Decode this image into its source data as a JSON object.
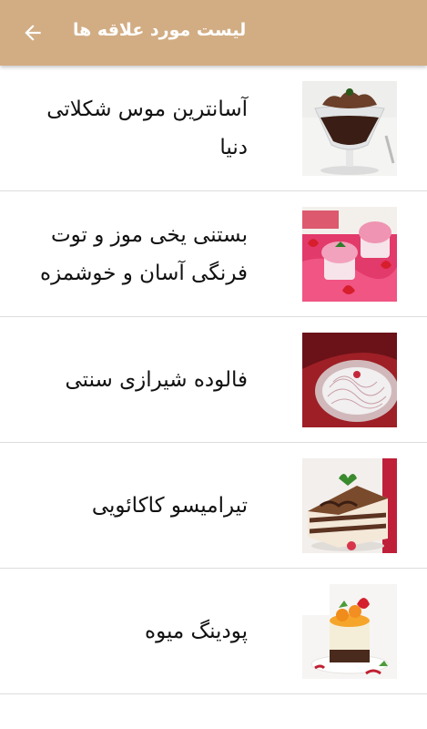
{
  "app_bar": {
    "title": "لیست مورد علاقه ها",
    "back_icon": "arrow-left-icon",
    "background": "#d2ad84"
  },
  "favorites": [
    {
      "title": "آسانترین موس شکلاتی دنیا",
      "image": "chocolate-mousse-image"
    },
    {
      "title": "بستنی یخی موز و توت فرنگی آسان و خوشمزه",
      "image": "strawberry-ice-cream-image"
    },
    {
      "title": "فالوده شیرازی سنتی",
      "image": "faloodeh-image"
    },
    {
      "title": "تیرامیسو کاکائویی",
      "image": "cocoa-tiramisu-image"
    },
    {
      "title": "پودینگ میوه",
      "image": "fruit-pudding-image"
    }
  ]
}
